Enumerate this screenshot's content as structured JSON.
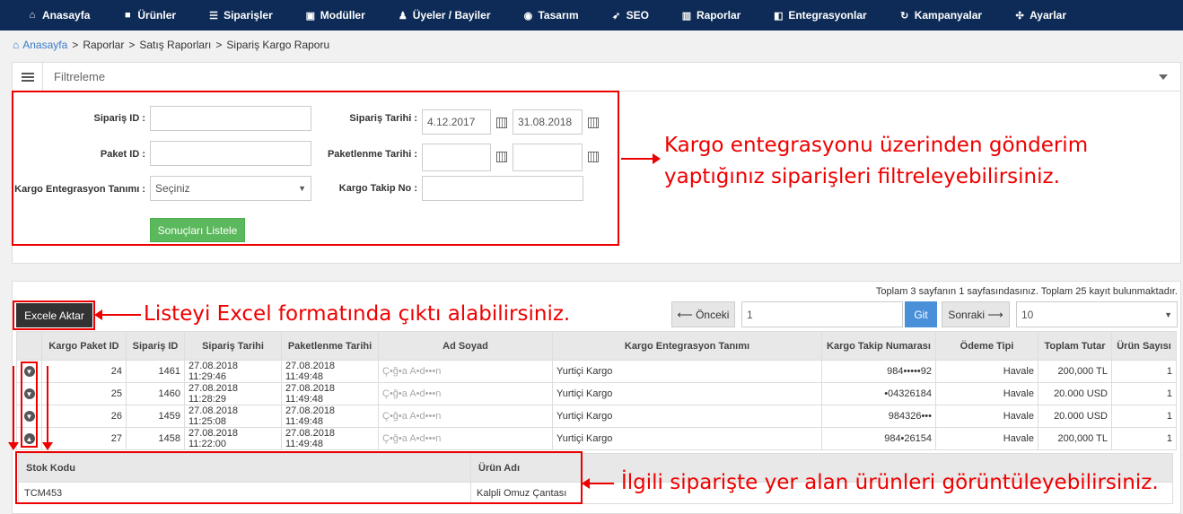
{
  "nav": {
    "items": [
      {
        "label": "Anasayfa",
        "icon": "⌂"
      },
      {
        "label": "Ürünler",
        "icon": "■"
      },
      {
        "label": "Siparişler",
        "icon": "☰"
      },
      {
        "label": "Modüller",
        "icon": "▣"
      },
      {
        "label": "Üyeler / Bayiler",
        "icon": "♟"
      },
      {
        "label": "Tasarım",
        "icon": "◉"
      },
      {
        "label": "SEO",
        "icon": "➶"
      },
      {
        "label": "Raporlar",
        "icon": "▥"
      },
      {
        "label": "Entegrasyonlar",
        "icon": "◧"
      },
      {
        "label": "Kampanyalar",
        "icon": "↻"
      },
      {
        "label": "Ayarlar",
        "icon": "✣"
      }
    ]
  },
  "breadcrumb": {
    "home": "Anasayfa",
    "items": [
      "Raporlar",
      "Satış Raporları",
      "Sipariş Kargo Raporu"
    ],
    "sep": ">"
  },
  "filter": {
    "title": "Filtreleme",
    "siparis_id_label": "Sipariş ID :",
    "paket_id_label": "Paket ID :",
    "kargo_tanim_label": "Kargo Entegrasyon Tanımı :",
    "kargo_tanim_value": "Seçiniz",
    "siparis_tarihi_label": "Sipariş Tarihi :",
    "siparis_tarihi_from": "4.12.2017",
    "siparis_tarihi_to": "31.08.2018",
    "paketlenme_tarihi_label": "Paketlenme Tarihi :",
    "takip_no_label": "Kargo Takip No :",
    "list_button": "Sonuçları Listele"
  },
  "annotations": {
    "filter_line1": "Kargo entegrasyonu üzerinden gönderim",
    "filter_line2": "yaptığınız siparişleri filtreleyebilirsiniz.",
    "excel": "Listeyi Excel formatında çıktı alabilirsiniz.",
    "products": "İlgili siparişte yer alan ürünleri görüntüleyebilirsiniz."
  },
  "list": {
    "page_info": "Toplam 3 sayfanın 1 sayfasındasınız. Toplam 25 kayıt bulunmaktadır.",
    "excel_button": "Excele Aktar",
    "prev_button": "⟵ Önceki",
    "page_value": "1",
    "go_button": "Git",
    "next_button": "Sonraki ⟶",
    "page_size": "10",
    "columns": [
      "",
      "Kargo Paket ID",
      "Sipariş ID",
      "Sipariş Tarihi",
      "Paketlenme Tarihi",
      "Ad Soyad",
      "Kargo Entegrasyon Tanımı",
      "Kargo Takip Numarası",
      "Ödeme Tipi",
      "Toplam Tutar",
      "Ürün Sayısı"
    ],
    "rows": [
      {
        "paket": "24",
        "siparis": "1461",
        "tarih": "27.08.2018 11:29:46",
        "paket_tarih": "27.08.2018 11:49:48",
        "ad": "Ç•ğ•a A•d•••n",
        "kargo": "Yurtiçi Kargo",
        "takip": "984•••••92",
        "odeme": "Havale",
        "tutar": "200,000 TL",
        "adet": "1"
      },
      {
        "paket": "25",
        "siparis": "1460",
        "tarih": "27.08.2018 11:28:29",
        "paket_tarih": "27.08.2018 11:49:48",
        "ad": "Ç•ğ•a A•d•••n",
        "kargo": "Yurtiçi Kargo",
        "takip": "•04326184",
        "odeme": "Havale",
        "tutar": "20.000 USD",
        "adet": "1"
      },
      {
        "paket": "26",
        "siparis": "1459",
        "tarih": "27.08.2018 11:25:08",
        "paket_tarih": "27.08.2018 11:49:48",
        "ad": "Ç•ğ•a A•d•••n",
        "kargo": "Yurtiçi Kargo",
        "takip": "984326•••",
        "odeme": "Havale",
        "tutar": "20.000 USD",
        "adet": "1"
      },
      {
        "paket": "27",
        "siparis": "1458",
        "tarih": "27.08.2018 11:22:00",
        "paket_tarih": "27.08.2018 11:49:48",
        "ad": "Ç•ğ•a A•d•••n",
        "kargo": "Yurtiçi Kargo",
        "takip": "984•26154",
        "odeme": "Havale",
        "tutar": "200,000 TL",
        "adet": "1"
      }
    ],
    "sub": {
      "columns": [
        "Stok Kodu",
        "Ürün Adı"
      ],
      "rows": [
        {
          "kod": "TCM453",
          "ad": "Kalpli Omuz Çantası"
        }
      ]
    }
  },
  "colors": {
    "nav_bg": "#0d2b56",
    "annotation": "#e00000",
    "green_button": "#5cb85c"
  }
}
